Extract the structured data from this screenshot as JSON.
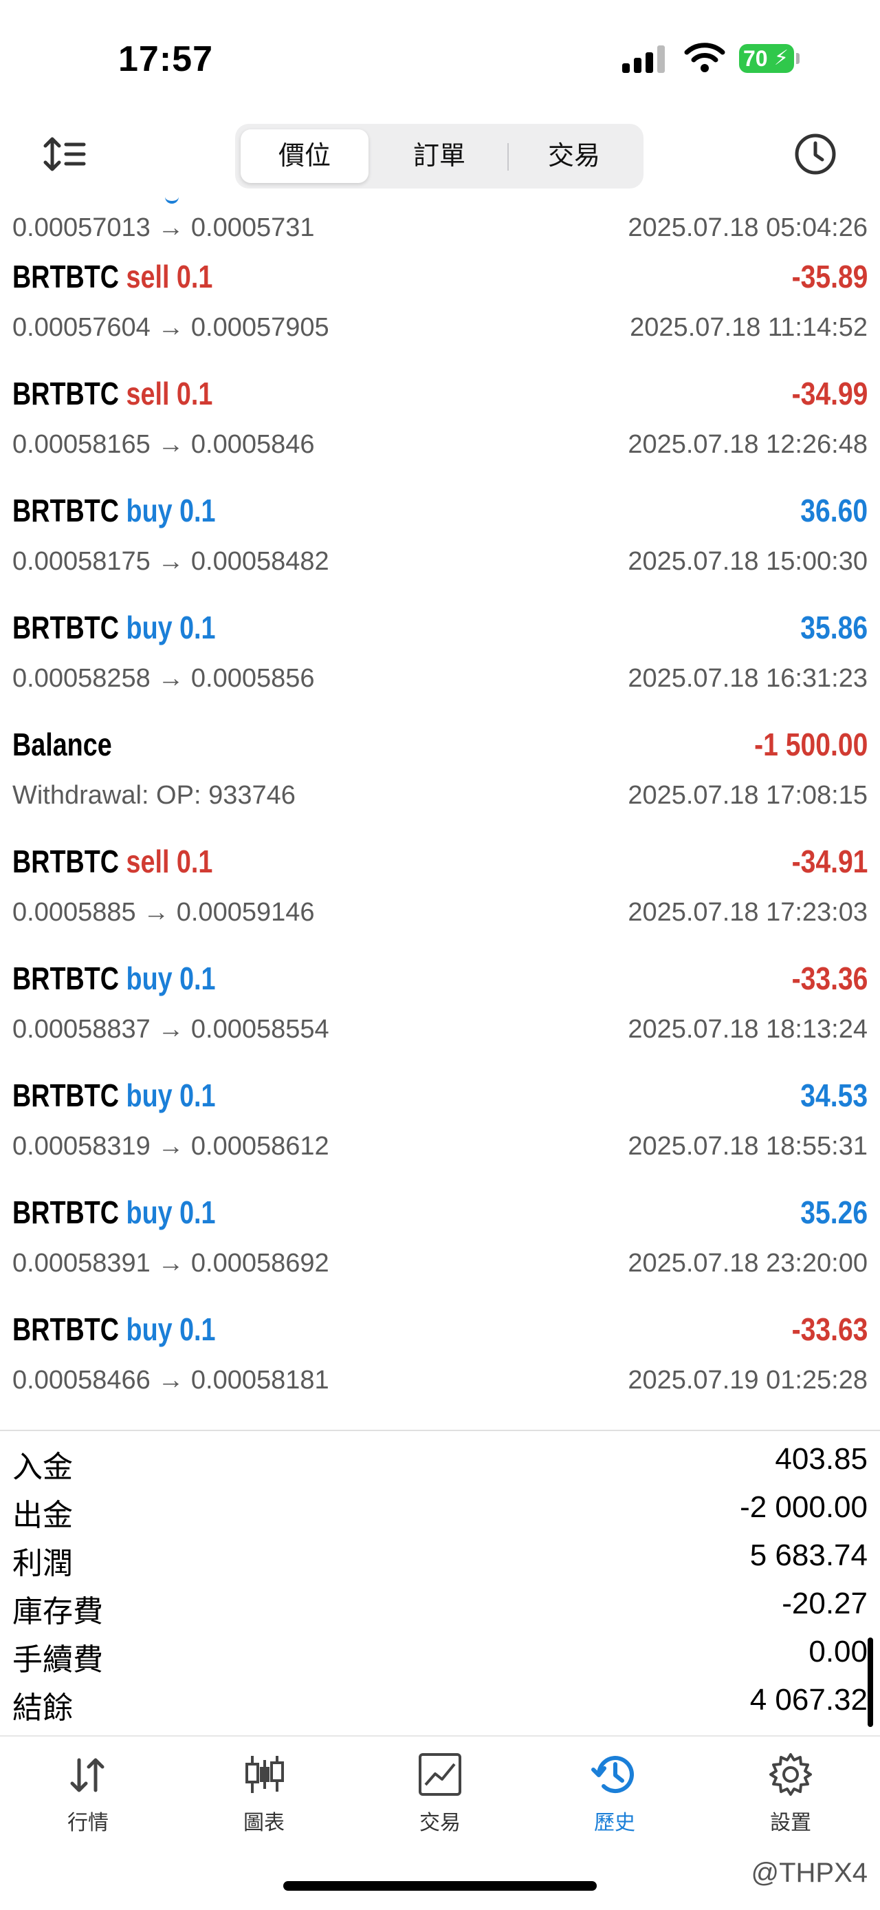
{
  "status_bar": {
    "time": "17:57",
    "battery": "70"
  },
  "toolbar": {
    "tabs": [
      {
        "label": "價位",
        "active": true
      },
      {
        "label": "訂單",
        "active": false
      },
      {
        "label": "交易",
        "active": false
      }
    ]
  },
  "partial_row": {
    "prices": "0.00057013 → 0.0005731",
    "time": "2025.07.18 05:04:26"
  },
  "deals": [
    {
      "symbol": "BRTBTC",
      "side": "sell 0.1",
      "side_color": "#d13b32",
      "profit": "-35.89",
      "profit_color": "#d13b32",
      "prices": "0.00057604 → 0.00057905",
      "time": "2025.07.18 11:14:52"
    },
    {
      "symbol": "BRTBTC",
      "side": "sell 0.1",
      "side_color": "#d13b32",
      "profit": "-34.99",
      "profit_color": "#d13b32",
      "prices": "0.00058165 → 0.0005846",
      "time": "2025.07.18 12:26:48"
    },
    {
      "symbol": "BRTBTC",
      "side": "buy 0.1",
      "side_color": "#1b7fd8",
      "profit": "36.60",
      "profit_color": "#1b7fd8",
      "prices": "0.00058175 → 0.00058482",
      "time": "2025.07.18 15:00:30"
    },
    {
      "symbol": "BRTBTC",
      "side": "buy 0.1",
      "side_color": "#1b7fd8",
      "profit": "35.86",
      "profit_color": "#1b7fd8",
      "prices": "0.00058258 → 0.0005856",
      "time": "2025.07.18 16:31:23"
    },
    {
      "symbol": "Balance",
      "side": "",
      "side_color": "#000000",
      "profit": "-1 500.00",
      "profit_color": "#d13b32",
      "prices": "Withdrawal:  OP: 933746",
      "time": "2025.07.18 17:08:15"
    },
    {
      "symbol": "BRTBTC",
      "side": "sell 0.1",
      "side_color": "#d13b32",
      "profit": "-34.91",
      "profit_color": "#d13b32",
      "prices": "0.0005885 → 0.00059146",
      "time": "2025.07.18 17:23:03"
    },
    {
      "symbol": "BRTBTC",
      "side": "buy 0.1",
      "side_color": "#1b7fd8",
      "profit": "-33.36",
      "profit_color": "#d13b32",
      "prices": "0.00058837 → 0.00058554",
      "time": "2025.07.18 18:13:24"
    },
    {
      "symbol": "BRTBTC",
      "side": "buy 0.1",
      "side_color": "#1b7fd8",
      "profit": "34.53",
      "profit_color": "#1b7fd8",
      "prices": "0.00058319 → 0.00058612",
      "time": "2025.07.18 18:55:31"
    },
    {
      "symbol": "BRTBTC",
      "side": "buy 0.1",
      "side_color": "#1b7fd8",
      "profit": "35.26",
      "profit_color": "#1b7fd8",
      "prices": "0.00058391 → 0.00058692",
      "time": "2025.07.18 23:20:00"
    },
    {
      "symbol": "BRTBTC",
      "side": "buy 0.1",
      "side_color": "#1b7fd8",
      "profit": "-33.63",
      "profit_color": "#d13b32",
      "prices": "0.00058466 → 0.00058181",
      "time": "2025.07.19 01:25:28"
    }
  ],
  "summary": [
    {
      "label": "入金",
      "value": "403.85"
    },
    {
      "label": "出金",
      "value": "-2 000.00"
    },
    {
      "label": "利潤",
      "value": "5 683.74"
    },
    {
      "label": "庫存費",
      "value": "-20.27"
    },
    {
      "label": "手續費",
      "value": "0.00"
    },
    {
      "label": "結餘",
      "value": "4 067.32"
    }
  ],
  "tab_bar": {
    "tabs": [
      {
        "label": "行情",
        "icon": "quotes-arrows-icon",
        "active": false
      },
      {
        "label": "圖表",
        "icon": "candlestick-chart-icon",
        "active": false
      },
      {
        "label": "交易",
        "icon": "trade-chart-icon",
        "active": false
      },
      {
        "label": "歷史",
        "icon": "history-clock-icon",
        "active": true
      },
      {
        "label": "設置",
        "icon": "settings-gear-icon",
        "active": false
      }
    ],
    "active_color": "#1b7fd8"
  },
  "watermark": "@THPX4"
}
